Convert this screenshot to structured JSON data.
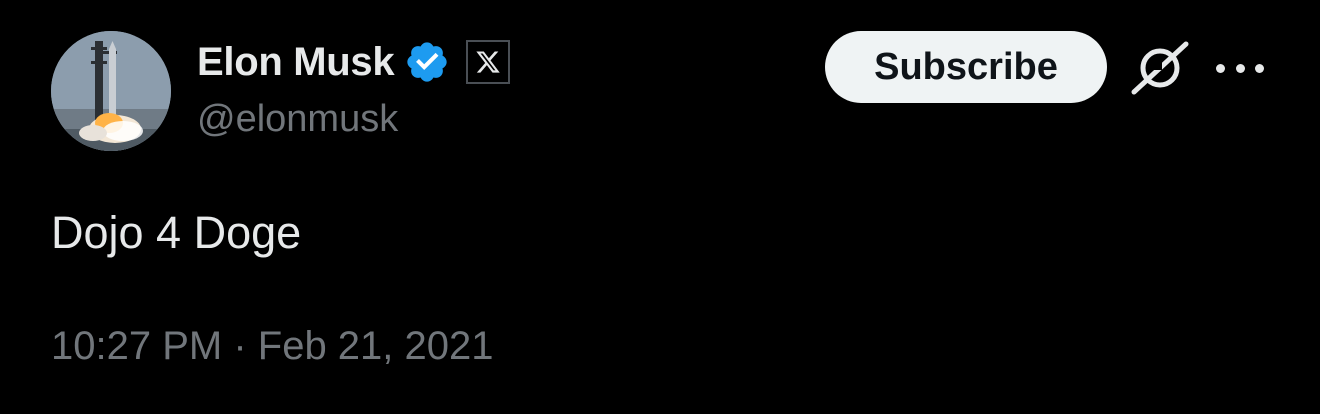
{
  "author": {
    "display_name": "Elon Musk",
    "handle": "@elonmusk",
    "verified_icon": "verified-badge-icon",
    "affiliate_icon": "x-logo-icon",
    "avatar_icon": "rocket-launch-avatar"
  },
  "actions": {
    "subscribe_label": "Subscribe",
    "grok_icon": "grok-icon",
    "more_icon": "more-options-icon"
  },
  "tweet": {
    "text": "Dojo 4 Doge"
  },
  "meta": {
    "timestamp": "10:27 PM · Feb 21, 2021"
  },
  "colors": {
    "background": "#000000",
    "primary_text": "#e7e9ea",
    "secondary_text": "#71767b",
    "verified_blue": "#1d9bf0",
    "subscribe_bg": "#eff3f4"
  }
}
